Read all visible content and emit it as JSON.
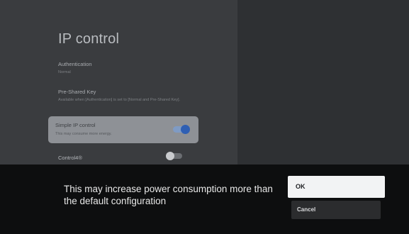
{
  "settings": {
    "title": "IP control",
    "authentication": {
      "label": "Authentication",
      "value": "Normal"
    },
    "pre_shared_key": {
      "label": "Pre-Shared Key",
      "description": "Available when [Authentication] is set to [Normal and Pre-Shared Key]."
    },
    "simple_ip_control": {
      "label": "Simple IP control",
      "description": "This may consume more energy.",
      "enabled": true
    },
    "control4": {
      "label": "Control4®",
      "enabled": false
    }
  },
  "dialog": {
    "message": "This may increase power consumption more than the default configuration",
    "ok_label": "OK",
    "cancel_label": "Cancel"
  },
  "colors": {
    "accent": "#2f5fb3",
    "focus_card": "#8e9196",
    "dialog_bg": "#0d0e0f"
  }
}
